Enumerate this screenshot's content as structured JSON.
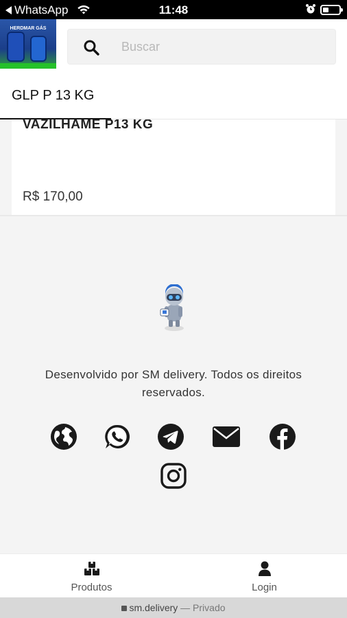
{
  "status_bar": {
    "back_app": "WhatsApp",
    "time": "11:48"
  },
  "header": {
    "logo_text": "HERDMAR GÁS",
    "search": {
      "placeholder": "Buscar",
      "value": ""
    }
  },
  "tabs": [
    {
      "label": "GLP P 13 KG",
      "active": true
    }
  ],
  "product": {
    "name": "VAZILHAME P13 KG",
    "price": "R$ 170,00"
  },
  "footer": {
    "credits": "Desenvolvido por SM delivery. Todos os direitos reservados.",
    "social_icons": [
      "globe-icon",
      "whatsapp-icon",
      "telegram-icon",
      "email-icon",
      "facebook-icon",
      "instagram-icon"
    ]
  },
  "bottom_nav": [
    {
      "label": "Produtos",
      "icon": "boxes-icon"
    },
    {
      "label": "Login",
      "icon": "user-icon"
    }
  ],
  "browser": {
    "domain": "sm.delivery",
    "separator": "—",
    "mode": "Privado"
  },
  "colors": {
    "status_bar_bg": "#000000",
    "page_bg": "#f4f4f4",
    "icon_dark": "#1a1a1a"
  }
}
